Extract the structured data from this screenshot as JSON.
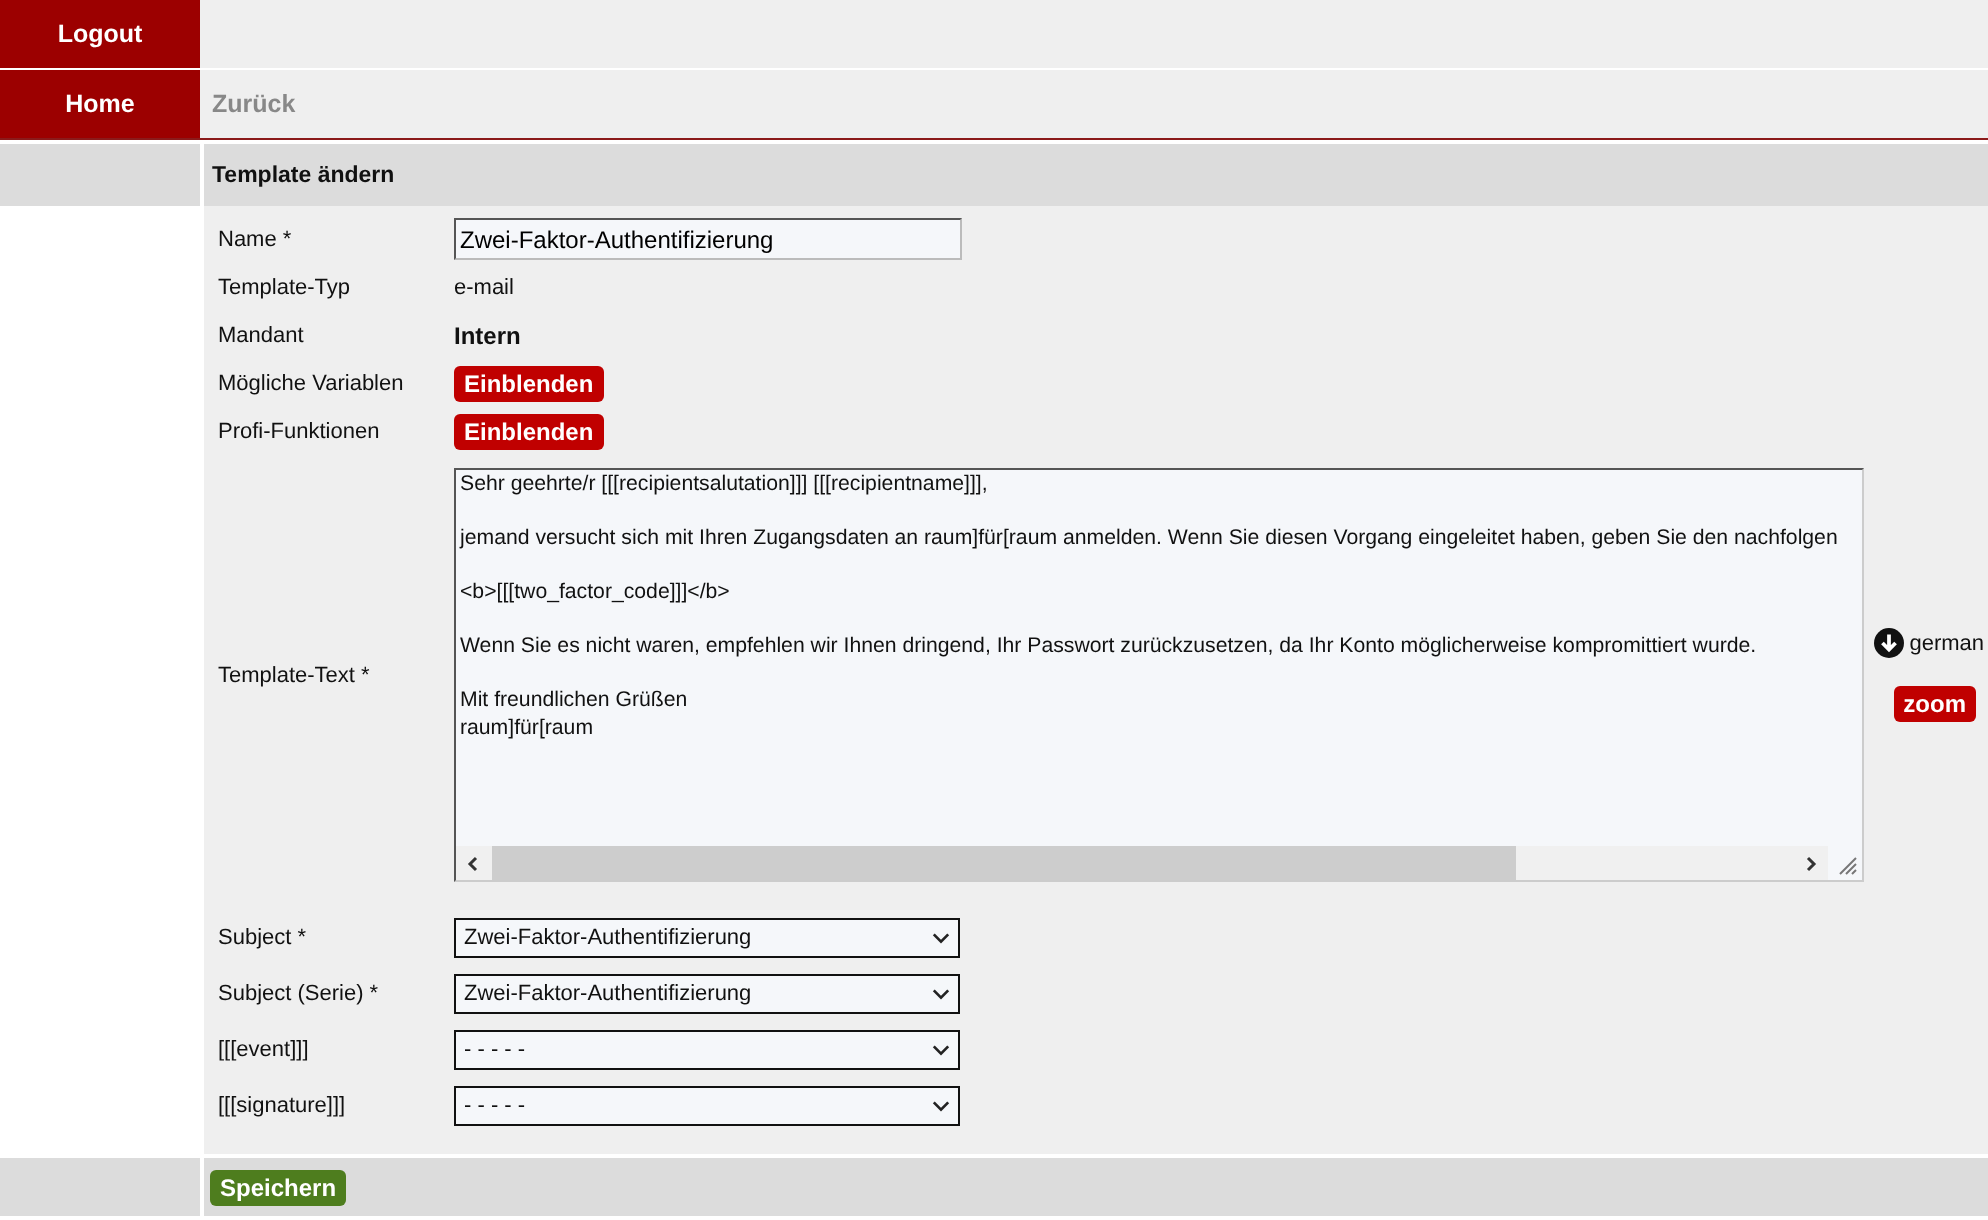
{
  "nav": [
    {
      "label": "Logout"
    },
    {
      "label": "Home",
      "back": "Zurück"
    }
  ],
  "section_title": "Template ändern",
  "fields": [
    {
      "kind": "input",
      "label": "Name *",
      "value": "Zwei-Faktor-Authentifizierung"
    },
    {
      "kind": "text",
      "label": "Template-Typ",
      "value": "e-mail"
    },
    {
      "kind": "strong",
      "label": "Mandant",
      "value": "Intern"
    },
    {
      "kind": "button",
      "label": "Mögliche Variablen",
      "value": "Einblenden"
    },
    {
      "kind": "button",
      "label": "Profi-Funktionen",
      "value": "Einblenden"
    },
    {
      "kind": "textarea",
      "label": "Template-Text *",
      "paragraphs": [
        [
          "Sehr geehrte/r [[[recipientsalutation]]] [[[recipientname]]],"
        ],
        [
          "jemand versucht sich mit Ihren Zugangsdaten an raum]für[raum anmelden. Wenn Sie diesen Vorgang eingeleitet haben, geben Sie den nachfolgen"
        ],
        [
          "<b>[[[two_factor_code]]]</b>"
        ],
        [
          "Wenn Sie es nicht waren, empfehlen wir Ihnen dringend, Ihr Passwort zurückzusetzen, da Ihr Konto möglicherweise kompromittiert wurde."
        ],
        [
          "Mit freundlichen Grüßen",
          "raum]für[raum"
        ]
      ],
      "language": "german",
      "zoom": "zoom"
    },
    {
      "kind": "select",
      "label": "Subject *",
      "value": "Zwei-Faktor-Authentifizierung"
    },
    {
      "kind": "select",
      "label": "Subject (Serie) *",
      "value": "Zwei-Faktor-Authentifizierung"
    },
    {
      "kind": "select",
      "label": "[[[event]]]",
      "value": "- - - - -"
    },
    {
      "kind": "select",
      "label": "[[[signature]]]",
      "value": "- - - - -"
    }
  ],
  "save": "Speichern"
}
